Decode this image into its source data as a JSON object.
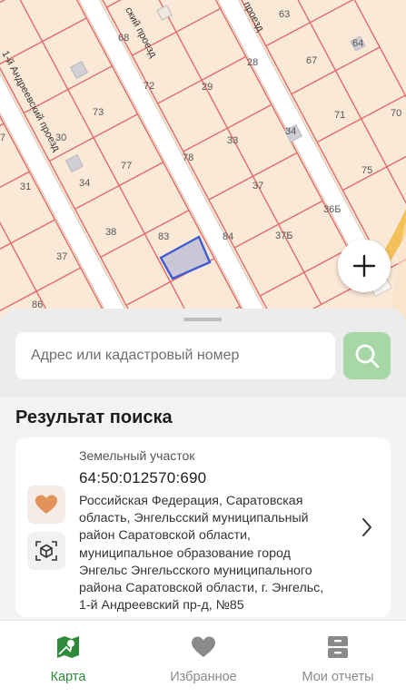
{
  "map": {
    "parcel_numbers": [
      "63",
      "68",
      "64",
      "67",
      "28",
      "72",
      "29",
      "70",
      "71",
      "73",
      "7",
      "30",
      "33",
      "34",
      "77",
      "78",
      "75",
      "31",
      "34",
      "37",
      "36Б",
      "83",
      "84",
      "37Б",
      "38",
      "37",
      "86"
    ],
    "streets": [
      "1-й Андреевский проезд",
      "ский проезд",
      "проезд"
    ]
  },
  "search": {
    "placeholder": "Адрес или кадастровый номер"
  },
  "results": {
    "title": "Результат поиска",
    "card": {
      "type": "Земельный участок",
      "cadastral_number": "64:50:012570:690",
      "address_lines": [
        "Российская Федерация, Саратовская",
        "область, Энгельсский муниципальный",
        "район Саратовской области,",
        "муниципальное образование город",
        "Энгельс Энгельсского муниципального",
        "района Саратовской области, г. Энгельс,",
        "1-й Андреевский пр-д, №85"
      ]
    }
  },
  "tabs": [
    {
      "label": "Карта",
      "icon": "map-icon",
      "active": true
    },
    {
      "label": "Избранное",
      "icon": "heart-icon",
      "active": false
    },
    {
      "label": "Мои отчеты",
      "icon": "archive-icon",
      "active": false
    }
  ],
  "colors": {
    "accent": "#2e8b3c",
    "search_button": "#a7d7a4",
    "map_background": "#fbe9d8",
    "parcel_lines": "#e26a6a",
    "road": "#ffffff",
    "selected_parcel": "#3f5bd1",
    "favorite_heart": "#e3925a"
  }
}
